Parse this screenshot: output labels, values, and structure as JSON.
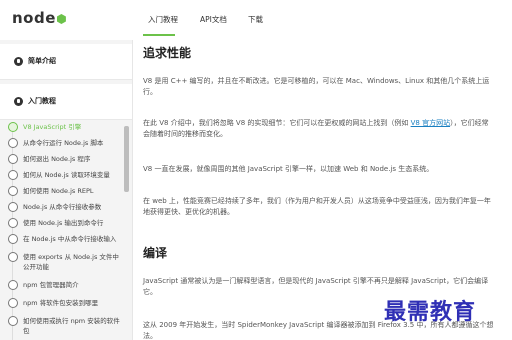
{
  "header": {
    "logo_text": "node",
    "nav": [
      "入门教程",
      "API文档",
      "下载"
    ]
  },
  "sidebar": {
    "sections": [
      "简单介绍",
      "入门教程"
    ],
    "items": [
      "V8 JavaScript 引擎",
      "从命令行运行 Node.js 脚本",
      "如何退出 Node.js 程序",
      "如何从 Node.js 读取环境变量",
      "如何使用 Node.js REPL",
      "Node.js 从命令行接收参数",
      "使用 Node.js 输出到命令行",
      "在 Node.js 中从命令行接收输入",
      "使用 exports 从 Node.js 文件中公开功能",
      "npm 包管理器简介",
      "npm 将软件包安装到哪里",
      "如何使用或执行 npm 安装的软件包"
    ]
  },
  "main": {
    "heading1": "追求性能",
    "p1": "V8 是用 C++ 编写的，并且在不断改进。它是可移植的，可以在 Mac、Windows、Linux 和其他几个系统上运行。",
    "p2_before": "在此 V8 介绍中，我们将忽略 V8 的实现细节：它们可以在更权威的网站上找到（例如 ",
    "p2_link": "V8 官方网站",
    "p2_after": "），它们经常会随着时间的推移而变化。",
    "p3": "V8 一直在发展，就像周围的其他 JavaScript 引擎一样，以加速 Web 和 Node.js 生态系统。",
    "p4": "在 web 上，性能竞赛已经持续了多年，我们（作为用户和开发人员）从这场竞争中受益匪浅，因为我们年复一年地获得更快、更优化的机器。",
    "heading2": "编译",
    "p5": "JavaScript 通常被认为是一门解释型语言，但是现代的 JavaScript 引擎不再只是解释 JavaScript，它们会编译它。",
    "p6": "这从 2009 年开始发生，当时 SpiderMonkey JavaScript 编译器被添加到 Firefox 3.5 中，所有人都遵循这个想法。"
  },
  "watermark": "最需教育",
  "colors": {
    "accent": "#6cc24a",
    "link": "#1a7fc1",
    "watermark": "#2f2fb5"
  }
}
